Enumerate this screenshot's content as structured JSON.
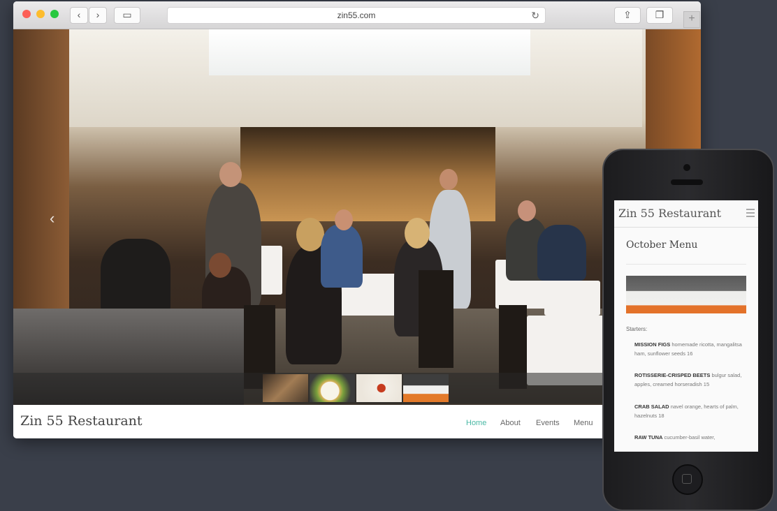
{
  "browser": {
    "url": "zin55.com",
    "icons": {
      "back": "chevron-left-icon",
      "forward": "chevron-right-icon",
      "sidebar": "sidebar-icon",
      "reload": "reload-icon",
      "share": "share-icon",
      "tabs": "tabs-icon",
      "new_tab": "plus-icon"
    },
    "glyphs": {
      "back": "‹",
      "forward": "›",
      "sidebar": "▭",
      "reload": "↻",
      "share": "⇪",
      "tabs": "❐",
      "new_tab": "+"
    }
  },
  "site": {
    "title": "Zin 55 Restaurant",
    "nav": [
      {
        "label": "Home",
        "active": true
      },
      {
        "label": "About",
        "active": false
      },
      {
        "label": "Events",
        "active": false
      },
      {
        "label": "Menu",
        "active": false
      }
    ],
    "hero_prev_glyph": "‹",
    "accent_color": "#49b8a4"
  },
  "mobile": {
    "site_title": "Zin 55 Restaurant",
    "page_title": "October Menu",
    "section": "Starters:",
    "items": [
      {
        "name": "MISSION FIGS",
        "description": "homemade ricotta, mangalitsa ham, sunflower seeds 16"
      },
      {
        "name": "ROTISSERIE-CRISPED BEETS",
        "description": "bulgur salad, apples, creamed horseradish 15"
      },
      {
        "name": "CRAB SALAD",
        "description": "navel orange, hearts of palm, hazelnuts 18"
      },
      {
        "name": "RAW TUNA",
        "description": "cucumber-basil water,"
      }
    ]
  }
}
